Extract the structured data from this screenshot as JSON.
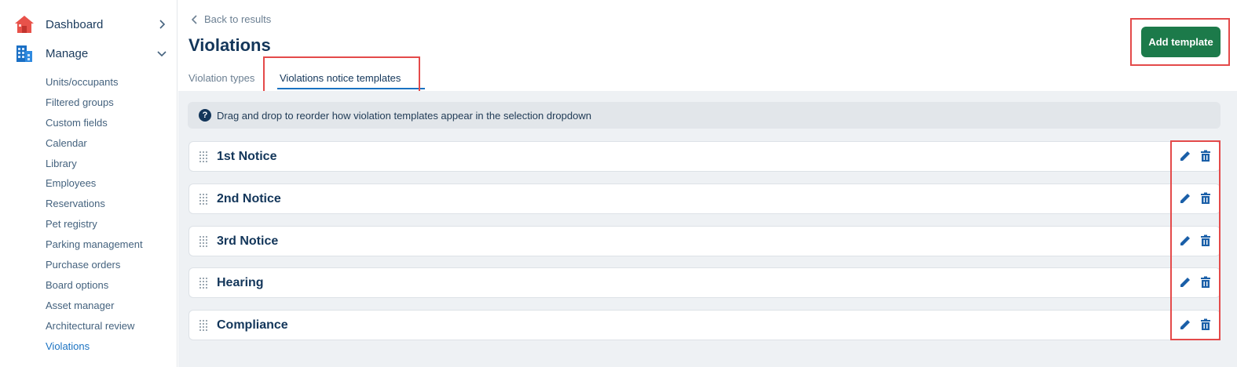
{
  "sidebar": {
    "top_items": [
      {
        "label": "Dashboard",
        "icon": "home-icon"
      },
      {
        "label": "Manage",
        "icon": "building-icon"
      }
    ],
    "sub_items": [
      {
        "label": "Units/occupants"
      },
      {
        "label": "Filtered groups"
      },
      {
        "label": "Custom fields"
      },
      {
        "label": "Calendar"
      },
      {
        "label": "Library"
      },
      {
        "label": "Employees"
      },
      {
        "label": "Reservations"
      },
      {
        "label": "Pet registry"
      },
      {
        "label": "Parking management"
      },
      {
        "label": "Purchase orders"
      },
      {
        "label": "Board options"
      },
      {
        "label": "Asset manager"
      },
      {
        "label": "Architectural review"
      },
      {
        "label": "Violations"
      }
    ],
    "active_item": "Violations"
  },
  "header": {
    "back_label": "Back to results",
    "title": "Violations",
    "add_button_label": "Add template"
  },
  "tabs": [
    {
      "label": "Violation types"
    },
    {
      "label": "Violations notice templates"
    }
  ],
  "active_tab": "Violations notice templates",
  "info": {
    "text": "Drag and drop to reorder how violation templates appear in the selection dropdown"
  },
  "templates": [
    {
      "label": "1st Notice"
    },
    {
      "label": "2nd Notice"
    },
    {
      "label": "3rd Notice"
    },
    {
      "label": "Hearing"
    },
    {
      "label": "Compliance"
    }
  ],
  "colors": {
    "primary_button": "#1c7a4a",
    "title_text": "#13365a",
    "link_active": "#1a72c2",
    "icon_blue": "#1a5fa8",
    "highlight_frame": "#e44a4a"
  }
}
